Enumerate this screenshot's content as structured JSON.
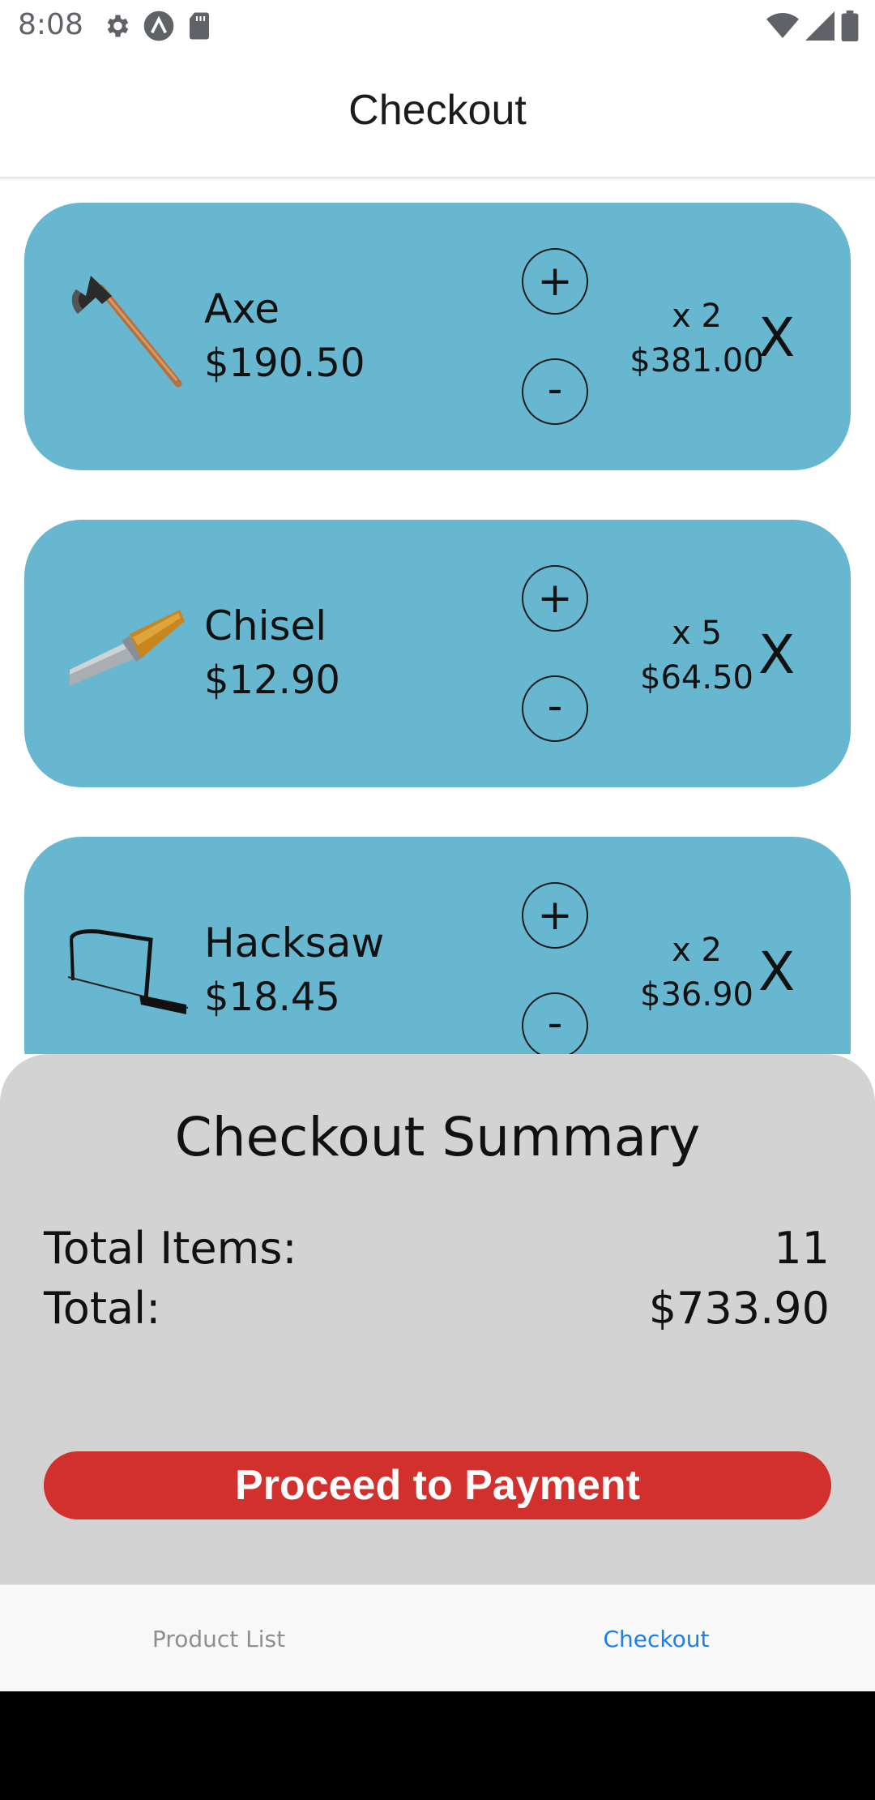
{
  "status_bar": {
    "time": "8:08",
    "left_icons": [
      "gear-icon",
      "expo-icon",
      "sd-card-icon"
    ],
    "right_icons": [
      "wifi-icon",
      "cell-signal-icon",
      "battery-icon"
    ]
  },
  "header": {
    "title": "Checkout"
  },
  "cart": {
    "plus_label": "+",
    "minus_label": "-",
    "remove_label": "X",
    "items": [
      {
        "name": "Axe",
        "price": "$190.50",
        "quantity": "x 2",
        "subtotal": "$381.00",
        "icon": "axe-icon"
      },
      {
        "name": "Chisel",
        "price": "$12.90",
        "quantity": "x 5",
        "subtotal": "$64.50",
        "icon": "chisel-icon"
      },
      {
        "name": "Hacksaw",
        "price": "$18.45",
        "quantity": "x 2",
        "subtotal": "$36.90",
        "icon": "hacksaw-icon"
      }
    ]
  },
  "summary": {
    "title": "Checkout Summary",
    "total_items_label": "Total Items:",
    "total_items_value": "11",
    "total_label": "Total:",
    "total_value": "$733.90",
    "pay_button_label": "Proceed to Payment"
  },
  "bottom_nav": {
    "items": [
      {
        "label": "Product List",
        "active": false
      },
      {
        "label": "Checkout",
        "active": true
      }
    ]
  },
  "colors": {
    "card": "#67b7d1",
    "summary_bg": "#d3d3d3",
    "pay_button": "#d2302c",
    "nav_active": "#1a7fe6",
    "nav_inactive": "#8e8e93"
  }
}
